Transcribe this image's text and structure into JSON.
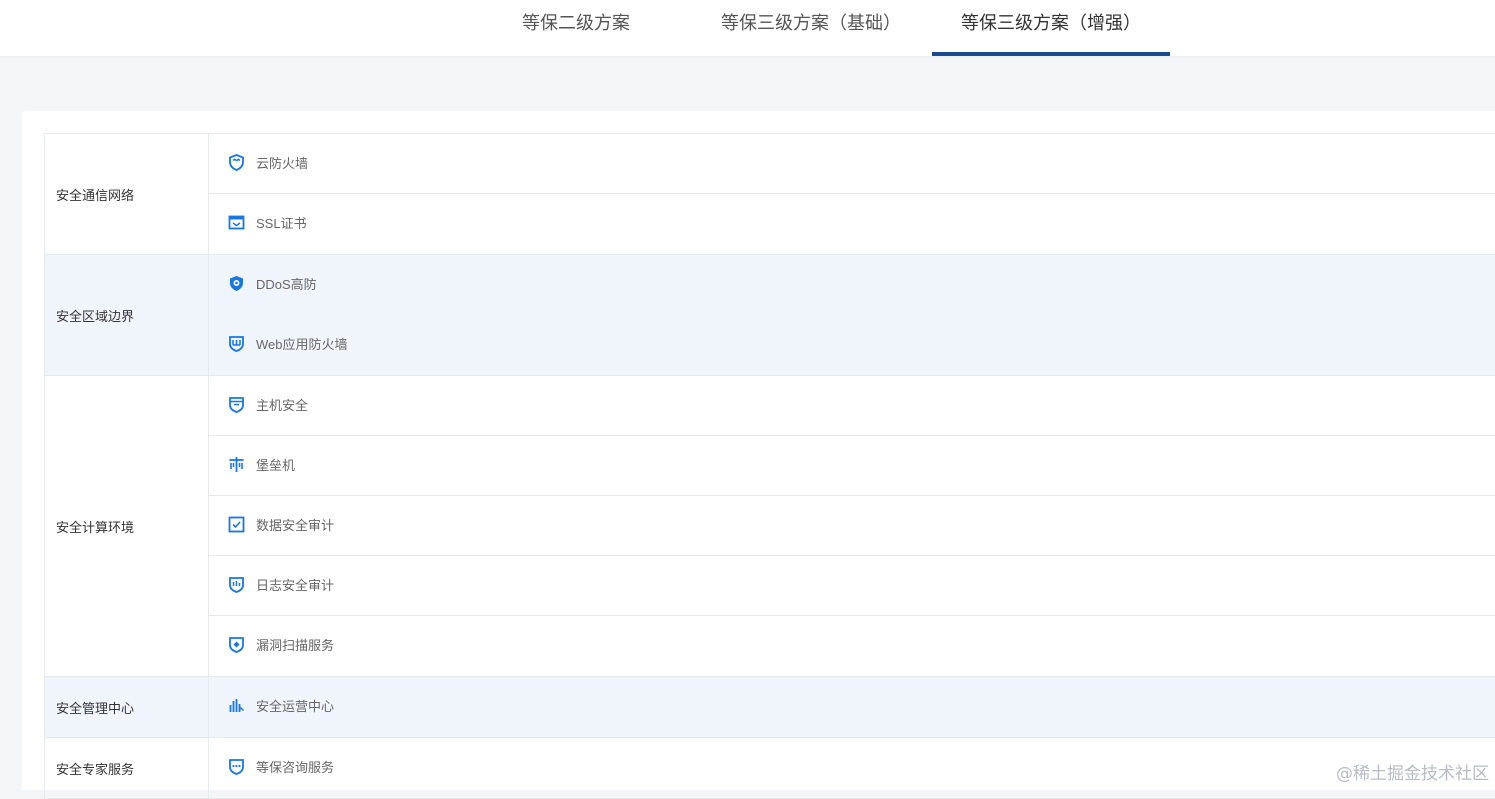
{
  "tabs": [
    {
      "label": "等保二级方案",
      "active": false
    },
    {
      "label": "等保三级方案（基础）",
      "active": false
    },
    {
      "label": "等保三级方案（增强）",
      "active": true
    }
  ],
  "accent_color": "#1a4a8f",
  "icon_color": "#1677e5",
  "groups": [
    {
      "label": "安全通信网络",
      "items": [
        {
          "label": "云防火墙",
          "icon": "firewall-shield-icon"
        },
        {
          "label": "SSL证书",
          "icon": "certificate-icon"
        }
      ]
    },
    {
      "label": "安全区域边界",
      "items": [
        {
          "label": "DDoS高防",
          "icon": "ddos-shield-icon"
        },
        {
          "label": "Web应用防火墙",
          "icon": "waf-shield-icon"
        }
      ]
    },
    {
      "label": "安全计算环境",
      "items": [
        {
          "label": "主机安全",
          "icon": "host-shield-icon"
        },
        {
          "label": "堡垒机",
          "icon": "bastion-icon"
        },
        {
          "label": "数据安全审计",
          "icon": "checkbox-audit-icon"
        },
        {
          "label": "日志安全审计",
          "icon": "log-shield-icon"
        },
        {
          "label": "漏洞扫描服务",
          "icon": "scan-shield-icon"
        }
      ]
    },
    {
      "label": "安全管理中心",
      "items": [
        {
          "label": "安全运营中心",
          "icon": "bar-chart-icon"
        }
      ]
    },
    {
      "label": "安全专家服务",
      "items": [
        {
          "label": "等保咨询服务",
          "icon": "consult-shield-icon"
        }
      ]
    }
  ],
  "watermark": "@稀土掘金技术社区"
}
